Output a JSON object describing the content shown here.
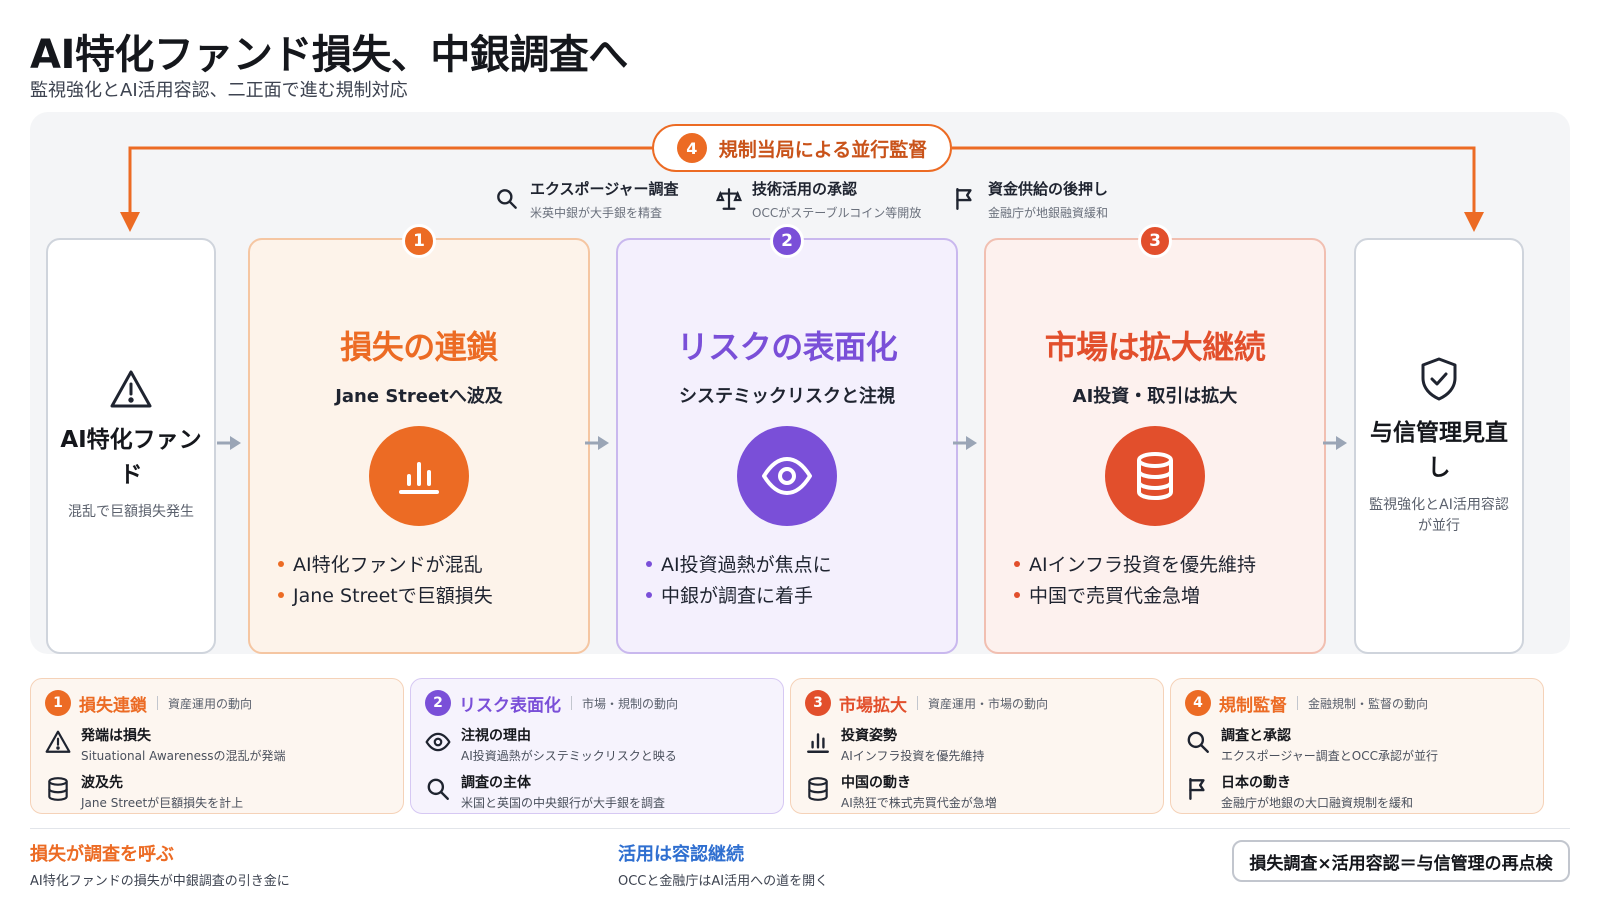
{
  "header": {
    "title": "AI特化ファンド損失、中銀調査へ",
    "subtitle": "監視強化とAI活用容認、二正面で進む規制対応"
  },
  "regulator": {
    "number": "4",
    "label": "規制当局による並行監督",
    "actions": [
      {
        "icon": "search-icon",
        "title": "エクスポージャー調査",
        "sub": "米英中銀が大手銀を精査"
      },
      {
        "icon": "scale-icon",
        "title": "技術活用の承認",
        "sub": "OCCがステーブルコイン等開放"
      },
      {
        "icon": "flag-icon",
        "title": "資金供給の後押し",
        "sub": "金融庁が地銀融資緩和"
      }
    ]
  },
  "start": {
    "icon": "warning-icon",
    "title": "AI特化ファンド",
    "sub": "混乱で巨額損失発生"
  },
  "stages": [
    {
      "number": "1",
      "color": "#ec6b24",
      "icon": "bar-chart-icon",
      "title": "損失の連鎖",
      "sub": "Jane Streetへ波及",
      "bullets": [
        "AI特化ファンドが混乱",
        "Jane Streetで巨額損失"
      ]
    },
    {
      "number": "2",
      "color": "#7a4fd8",
      "icon": "eye-icon",
      "title": "リスクの表面化",
      "sub": "システミックリスクと注視",
      "bullets": [
        "AI投資過熱が焦点に",
        "中銀が調査に着手"
      ]
    },
    {
      "number": "3",
      "color": "#e24f2c",
      "icon": "database-icon",
      "title": "市場は拡大継続",
      "sub": "AI投資・取引は拡大",
      "bullets": [
        "AIインフラ投資を優先維持",
        "中国で売買代金急増"
      ]
    }
  ],
  "end": {
    "icon": "shield-check-icon",
    "title": "与信管理見直し",
    "sub": "監視強化とAI活用容認が並行"
  },
  "summary": [
    {
      "number": "1",
      "name": "損失連鎖",
      "category": "資産運用の動向",
      "items": [
        {
          "icon": "warning-icon",
          "title": "発端は損失",
          "sub": "Situational Awarenessの混乱が発端"
        },
        {
          "icon": "database-icon",
          "title": "波及先",
          "sub": "Jane Streetが巨額損失を計上"
        }
      ]
    },
    {
      "number": "2",
      "name": "リスク表面化",
      "category": "市場・規制の動向",
      "items": [
        {
          "icon": "eye-icon",
          "title": "注視の理由",
          "sub": "AI投資過熱がシステミックリスクと映る"
        },
        {
          "icon": "search-icon",
          "title": "調査の主体",
          "sub": "米国と英国の中央銀行が大手銀を調査"
        }
      ]
    },
    {
      "number": "3",
      "name": "市場拡大",
      "category": "資産運用・市場の動向",
      "items": [
        {
          "icon": "bar-chart-icon",
          "title": "投資姿勢",
          "sub": "AIインフラ投資を優先維持"
        },
        {
          "icon": "database-icon",
          "title": "中国の動き",
          "sub": "AI熱狂で株式売買代金が急増"
        }
      ]
    },
    {
      "number": "4",
      "name": "規制監督",
      "category": "金融規制・監督の動向",
      "items": [
        {
          "icon": "search-icon",
          "title": "調査と承認",
          "sub": "エクスポージャー調査とOCC承認が並行"
        },
        {
          "icon": "flag-icon",
          "title": "日本の動き",
          "sub": "金融庁が地銀の大口融資規制を緩和"
        }
      ]
    }
  ],
  "footer": {
    "left": {
      "title": "損失が調査を呼ぶ",
      "sub": "AI特化ファンドの損失が中銀調査の引き金に",
      "color": "#ec6b24"
    },
    "center": {
      "title": "活用は容認継続",
      "sub": "OCCと金融庁はAI活用への道を開く",
      "color": "#2f6fd0"
    },
    "formula": "損失調査×活用容認＝与信管理の再点検"
  }
}
